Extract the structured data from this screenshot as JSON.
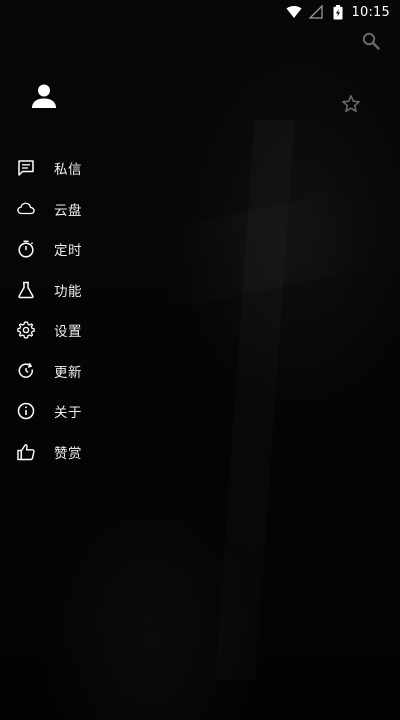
{
  "status_bar": {
    "time": "10:15",
    "icons": [
      "wifi-icon",
      "signal-icon",
      "battery-icon"
    ]
  },
  "header": {
    "search_icon": "search-icon",
    "star_icon": "star-outline-icon",
    "avatar_icon": "user-icon"
  },
  "menu": {
    "items": [
      {
        "label": "私信",
        "icon": "message-icon"
      },
      {
        "label": "云盘",
        "icon": "cloud-icon"
      },
      {
        "label": "定时",
        "icon": "timer-icon"
      },
      {
        "label": "功能",
        "icon": "flask-icon"
      },
      {
        "label": "设置",
        "icon": "gear-icon"
      },
      {
        "label": "更新",
        "icon": "refresh-icon"
      },
      {
        "label": "关于",
        "icon": "info-icon"
      },
      {
        "label": "赞赏",
        "icon": "thumbs-up-icon"
      }
    ]
  },
  "colors": {
    "background": "#050505",
    "text": "#f0f0f0",
    "icon_dim": "#6a6a6a"
  }
}
